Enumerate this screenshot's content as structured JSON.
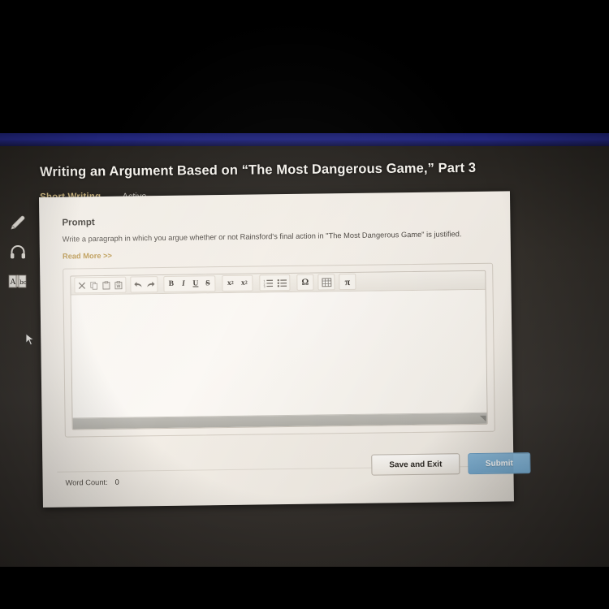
{
  "header": {
    "title": "Writing an Argument Based on “The Most Dangerous Game,” Part 3",
    "category": "Short Writing",
    "state": "Active"
  },
  "sidebar": {
    "items": [
      {
        "name": "pencil-icon",
        "label": "Annotate"
      },
      {
        "name": "headphones-icon",
        "label": "Listen"
      },
      {
        "name": "dictionary-icon",
        "label": "Glossary"
      }
    ]
  },
  "prompt": {
    "heading": "Prompt",
    "body": "Write a paragraph in which you argue whether or not Rainsford's final action in \"The Most Dangerous Game\" is justified.",
    "read_more": "Read More >>"
  },
  "editor": {
    "content": "",
    "placeholder": "",
    "toolbar_groups": [
      {
        "name": "clipboard",
        "buttons": [
          {
            "name": "cut-icon",
            "label": "Cut",
            "glyph": "✕"
          },
          {
            "name": "copy-icon",
            "label": "Copy",
            "glyph": "copy"
          },
          {
            "name": "paste-icon",
            "label": "Paste",
            "glyph": "paste"
          },
          {
            "name": "paste-from-word-icon",
            "label": "Paste from Word",
            "glyph": "paste-w"
          }
        ]
      },
      {
        "name": "history",
        "buttons": [
          {
            "name": "undo-icon",
            "label": "Undo",
            "glyph": "↶"
          },
          {
            "name": "redo-icon",
            "label": "Redo",
            "glyph": "↷"
          }
        ]
      },
      {
        "name": "text-style",
        "buttons": [
          {
            "name": "bold-icon",
            "label": "Bold",
            "glyph": "B"
          },
          {
            "name": "italic-icon",
            "label": "Italic",
            "glyph": "I"
          },
          {
            "name": "underline-icon",
            "label": "Underline",
            "glyph": "U"
          },
          {
            "name": "strikethrough-icon",
            "label": "Strikethrough",
            "glyph": "S"
          }
        ]
      },
      {
        "name": "script",
        "buttons": [
          {
            "name": "subscript-icon",
            "label": "Subscript",
            "glyph": "x₂"
          },
          {
            "name": "superscript-icon",
            "label": "Superscript",
            "glyph": "x²"
          }
        ]
      },
      {
        "name": "lists",
        "buttons": [
          {
            "name": "numbered-list-icon",
            "label": "Insert/Remove Numbered List",
            "glyph": "ol"
          },
          {
            "name": "bulleted-list-icon",
            "label": "Insert/Remove Bulleted List",
            "glyph": "ul"
          }
        ]
      },
      {
        "name": "insert",
        "buttons": [
          {
            "name": "special-character-icon",
            "label": "Insert Special Character",
            "glyph": "Ω"
          },
          {
            "name": "table-icon",
            "label": "Insert Table",
            "glyph": "table"
          },
          {
            "name": "math-icon",
            "label": "Insert Math",
            "glyph": "π"
          }
        ]
      }
    ]
  },
  "footer": {
    "word_count_label": "Word Count:",
    "word_count_value": "0",
    "save_label": "Save and Exit",
    "submit_label": "Submit"
  },
  "colors": {
    "accent_gold": "#d8c189",
    "link_gold": "#b89449",
    "submit_blue": "#79aed3",
    "screen_dark": "#332f2a",
    "card_beige": "#efeae2"
  }
}
